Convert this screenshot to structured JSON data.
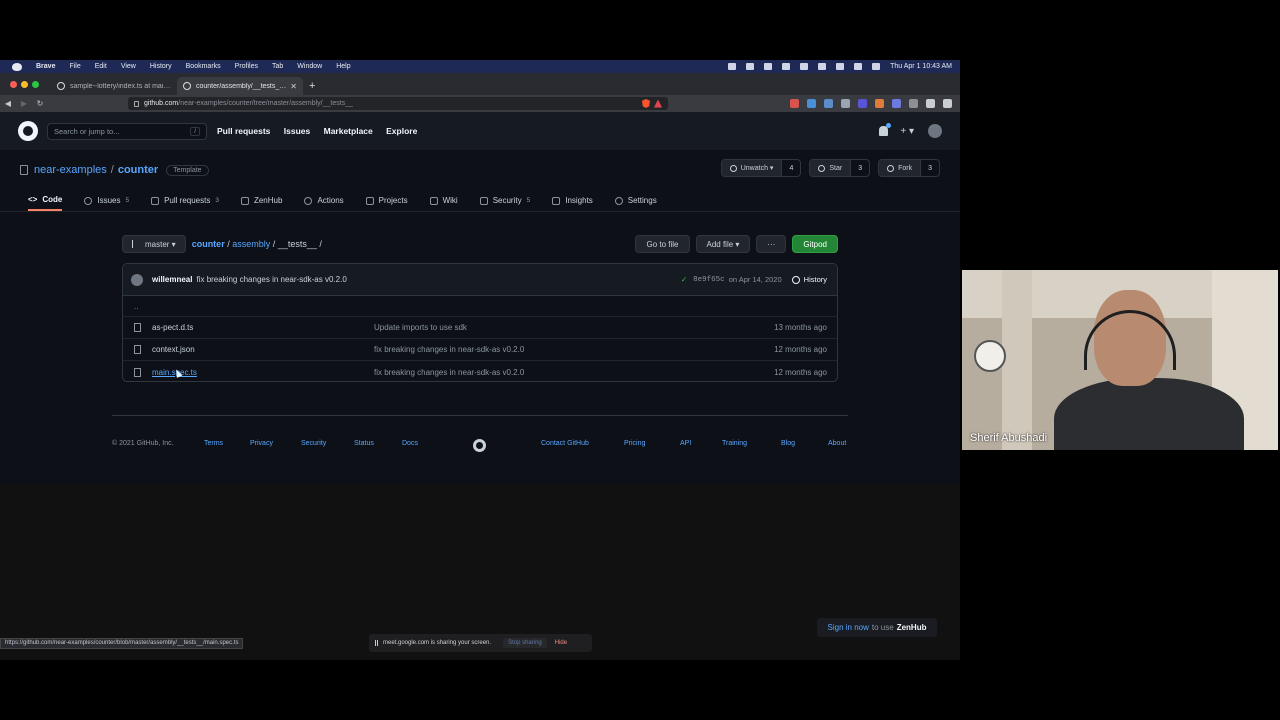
{
  "mac_menu": {
    "items": [
      "Brave",
      "File",
      "Edit",
      "View",
      "History",
      "Bookmarks",
      "Profiles",
      "Tab",
      "Window",
      "Help"
    ],
    "clock": "Thu Apr 1  10:43 AM"
  },
  "browser": {
    "tabs": [
      {
        "title": "sample--lottery/index.ts at main ·",
        "active": false
      },
      {
        "title": "counter/assembly/__tests__ at",
        "active": true
      }
    ],
    "url_host": "github.com",
    "url_path": "/near-examples/counter/tree/master/assembly/__tests__",
    "status_url": "https://github.com/near-examples/counter/blob/master/assembly/__tests__/main.spec.ts"
  },
  "github": {
    "search_placeholder": "Search or jump to...",
    "search_key": "/",
    "nav": [
      "Pull requests",
      "Issues",
      "Marketplace",
      "Explore"
    ],
    "plus": "+ ▾",
    "repo": {
      "owner": "near-examples",
      "sep": "/",
      "name": "counter",
      "badge": "Template"
    },
    "actions": [
      {
        "label": "Unwatch ▾",
        "count": "4"
      },
      {
        "label": "Star",
        "count": "3"
      },
      {
        "label": "Fork",
        "count": "3"
      }
    ],
    "tabs": [
      {
        "label": "Code",
        "count": ""
      },
      {
        "label": "Issues",
        "count": "5"
      },
      {
        "label": "Pull requests",
        "count": "3"
      },
      {
        "label": "ZenHub",
        "count": ""
      },
      {
        "label": "Actions",
        "count": ""
      },
      {
        "label": "Projects",
        "count": ""
      },
      {
        "label": "Wiki",
        "count": ""
      },
      {
        "label": "Security",
        "count": "5"
      },
      {
        "label": "Insights",
        "count": ""
      },
      {
        "label": "Settings",
        "count": ""
      }
    ],
    "branch": "master ▾",
    "breadcrumb": {
      "root": "counter",
      "dir": "assembly",
      "current": "__tests__",
      "sep": "/"
    },
    "buttons": {
      "go_to_file": "Go to file",
      "add_file": "Add file ▾",
      "more": "···",
      "gitpod": "Gitpod"
    },
    "commit": {
      "author": "willemneal",
      "message": "fix breaking changes in near-sdk-as v0.2.0",
      "check": "✓",
      "sha": "8e9f65c",
      "date": "on Apr 14, 2020",
      "history": "History"
    },
    "parent_dir": "..",
    "files": [
      {
        "name": "as-pect.d.ts",
        "message": "Update imports to use sdk",
        "age": "13 months ago"
      },
      {
        "name": "context.json",
        "message": "fix breaking changes in near-sdk-as v0.2.0",
        "age": "12 months ago"
      },
      {
        "name": "main.spec.ts",
        "message": "fix breaking changes in near-sdk-as v0.2.0",
        "age": "12 months ago"
      }
    ],
    "footer": {
      "copyright": "© 2021 GitHub, Inc.",
      "links_left": [
        "Terms",
        "Privacy",
        "Security",
        "Status",
        "Docs"
      ],
      "links_right": [
        "Contact GitHub",
        "Pricing",
        "API",
        "Training",
        "Blog",
        "About"
      ]
    }
  },
  "zenhub": {
    "link": "Sign in now",
    "text": "to use",
    "brand": "ZenHub"
  },
  "sharing": {
    "message": "meet.google.com is sharing your screen.",
    "stop": "Stop sharing",
    "hide": "Hide"
  },
  "video": {
    "name": "Sherif Abushadi"
  },
  "colors": {
    "accent": "#58a6ff",
    "gitpod": "#238636",
    "active_tab_underline": "#f78166",
    "mac_menubar": "#1e2a55"
  }
}
